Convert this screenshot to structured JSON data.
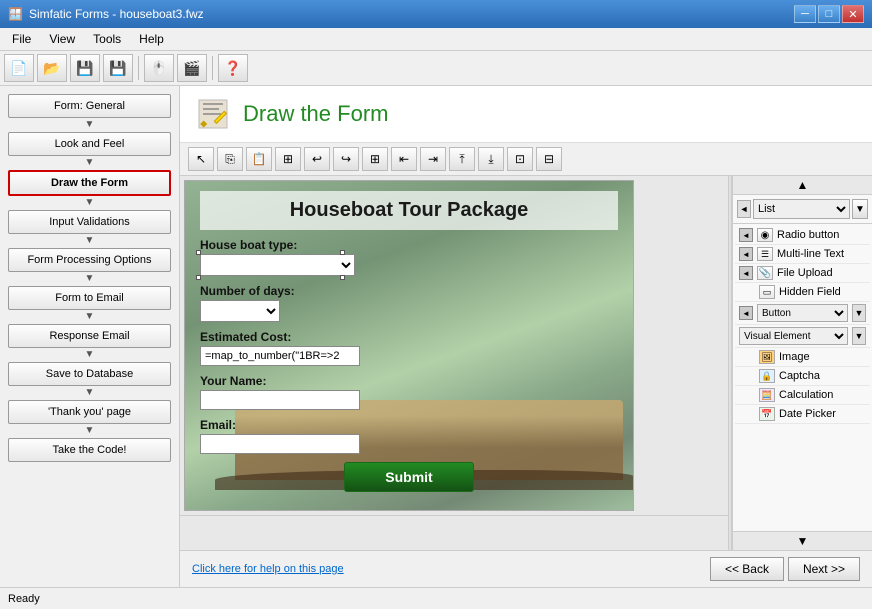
{
  "titleBar": {
    "title": "Simfatic Forms - houseboat3.fwz",
    "controls": [
      "minimize",
      "maximize",
      "close"
    ]
  },
  "menuBar": {
    "items": [
      "File",
      "View",
      "Tools",
      "Help"
    ]
  },
  "toolbar": {
    "buttons": [
      "new",
      "open",
      "save",
      "save-as",
      "cursor",
      "film",
      "help"
    ]
  },
  "sidebar": {
    "items": [
      {
        "id": "form-general",
        "label": "Form: General",
        "active": false
      },
      {
        "id": "look-and-feel",
        "label": "Look and Feel",
        "active": false
      },
      {
        "id": "draw-the-form",
        "label": "Draw the Form",
        "active": true
      },
      {
        "id": "input-validations",
        "label": "Input Validations",
        "active": false
      },
      {
        "id": "form-processing-options",
        "label": "Form Processing Options",
        "active": false
      },
      {
        "id": "form-to-email",
        "label": "Form to Email",
        "active": false
      },
      {
        "id": "response-email",
        "label": "Response Email",
        "active": false
      },
      {
        "id": "save-to-database",
        "label": "Save to Database",
        "active": false
      },
      {
        "id": "thank-you-page",
        "label": "'Thank you' page",
        "active": false
      },
      {
        "id": "take-the-code",
        "label": "Take the Code!",
        "active": false
      }
    ]
  },
  "pageHeader": {
    "icon": "✏️",
    "title": "Draw the Form"
  },
  "formPreview": {
    "title": "Houseboat Tour Package",
    "fields": [
      {
        "label": "House boat type:",
        "type": "select",
        "value": ""
      },
      {
        "label": "Number of days:",
        "type": "select",
        "value": ""
      },
      {
        "label": "Estimated Cost:",
        "type": "calculated",
        "value": "=map_to_number(\"1BR=>2"
      },
      {
        "label": "Your Name:",
        "type": "text",
        "value": ""
      },
      {
        "label": "Email:",
        "type": "text",
        "value": ""
      }
    ],
    "submitLabel": "Submit"
  },
  "rightPanel": {
    "dropdownLabel": "List",
    "items": [
      {
        "id": "radio-button",
        "label": "Radio button",
        "hasArrow": true,
        "icon": "◉"
      },
      {
        "id": "multi-line-text",
        "label": "Multi-line Text",
        "hasArrow": true,
        "icon": "☰"
      },
      {
        "id": "file-upload",
        "label": "File Upload",
        "hasArrow": true,
        "icon": "📎"
      },
      {
        "id": "hidden-field",
        "label": "Hidden Field",
        "hasArrow": false,
        "icon": "▭"
      },
      {
        "id": "button",
        "label": "Button",
        "hasArrow": true,
        "icon": "▬"
      },
      {
        "id": "visual-element",
        "label": "Visual Element",
        "hasArrow": false,
        "icon": "◈"
      },
      {
        "id": "image",
        "label": "Image",
        "hasArrow": false,
        "icon": "🖼"
      },
      {
        "id": "captcha",
        "label": "Captcha",
        "hasArrow": false,
        "icon": "🔒"
      },
      {
        "id": "calculation",
        "label": "Calculation",
        "hasArrow": false,
        "icon": "🧮"
      },
      {
        "id": "date-picker",
        "label": "Date Picker",
        "hasArrow": false,
        "icon": "📅"
      }
    ]
  },
  "bottomBar": {
    "helpText": "Click here for help on this page",
    "backLabel": "<< Back",
    "nextLabel": "Next >>"
  },
  "statusBar": {
    "text": "Ready"
  }
}
